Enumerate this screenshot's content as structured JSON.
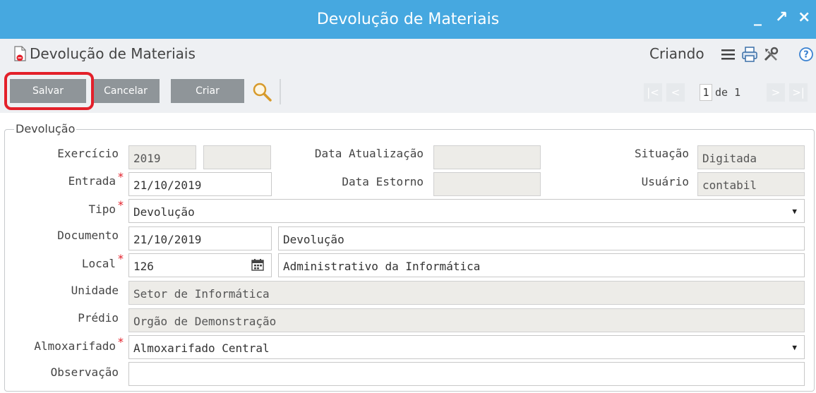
{
  "window": {
    "title": "Devolução de Materiais",
    "controls": [
      "_",
      "↗",
      "×"
    ]
  },
  "header": {
    "title": "Devolução de Materiais",
    "status": "Criando",
    "icons": [
      "menu-icon",
      "print-icon",
      "tools-icon",
      "help-icon"
    ]
  },
  "toolbar": {
    "save_label": "Salvar",
    "cancel_label": "Cancelar",
    "create_label": "Criar",
    "save_highlight_color": "#e3202a"
  },
  "pager": {
    "current": "1",
    "of_text": "de 1",
    "first": "|<",
    "prev": "<",
    "next": ">",
    "last": ">|"
  },
  "form": {
    "legend": "Devolução",
    "labels": {
      "exercicio": "Exercício",
      "entrada": "Entrada",
      "tipo": "Tipo",
      "documento": "Documento",
      "local": "Local",
      "unidade": "Unidade",
      "predio": "Prédio",
      "almoxarifado": "Almoxarifado",
      "observacao": "Observação",
      "data_atualizacao": "Data Atualização",
      "data_estorno": "Data Estorno",
      "situacao": "Situação",
      "usuario": "Usuário"
    },
    "required_mark": "*",
    "values": {
      "exercicio": "2019",
      "exercicio_extra": "",
      "entrada": "21/10/2019",
      "data_atualizacao": "",
      "data_estorno": "",
      "situacao": "Digitada",
      "usuario": "contabil",
      "tipo": "Devolução",
      "documento_data": "21/10/2019",
      "documento_desc": "Devolução",
      "local_code": "126",
      "local_desc": "Administrativo da Informática",
      "unidade": "Setor de Informática",
      "predio": "Orgão de Demonstração",
      "almoxarifado": "Almoxarifado Central",
      "observacao": ""
    }
  },
  "colors": {
    "titlebar": "#46a8e0",
    "button": "#8f9599",
    "required": "#e3202a",
    "readonly_field": "#edece8"
  }
}
